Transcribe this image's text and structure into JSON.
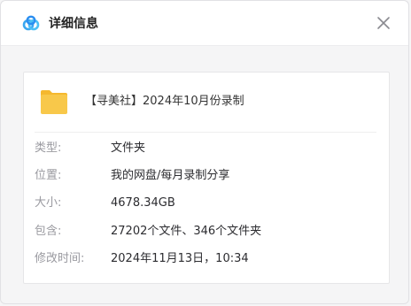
{
  "header": {
    "title": "详细信息",
    "logo_icon": "baidu-netdisk-logo-icon",
    "close_icon": "close-icon"
  },
  "file": {
    "icon": "folder-icon",
    "name": "【寻美社】2024年10月份录制",
    "folder_color": "#f8c84a"
  },
  "details": [
    {
      "label": "类型:",
      "value": "文件夹"
    },
    {
      "label": "位置:",
      "value": "我的网盘/每月录制分享"
    },
    {
      "label": "大小:",
      "value": "4678.34GB"
    },
    {
      "label": "包含:",
      "value": "27202个文件、346个文件夹"
    },
    {
      "label": "修改时间:",
      "value": "2024年11月13日，10:34"
    }
  ]
}
